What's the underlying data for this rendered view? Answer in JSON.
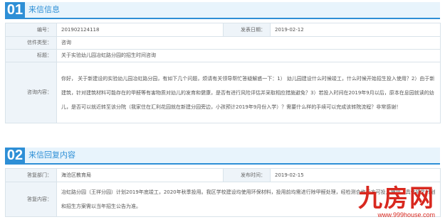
{
  "section1": {
    "num": "01",
    "title": "来信信息",
    "rows": {
      "number_label": "编号：",
      "number_value": "201902124118",
      "date_label": "发表日期：",
      "date_value": "2019-02-12",
      "type_label": "信件类型：",
      "type_value": "咨询",
      "subject_label": "标题：",
      "subject_value": "关于实验幼儿园冶虹路分园的招生时间咨询",
      "content_label": "咨询内容：",
      "content_value": "你好， 关于新建设的实验幼儿园冶虹路分园，有如下几个问题，烦请有关领导帮忙答疑解惑一下：1） 幼儿园建设什么时候竣工，什么时候开始招生投入使用？2）由于新建筑，针对建筑材料可能存在的甲醛等有害物质对幼儿的发育和健康，是否有进行风险评估并采取相应措施避免？3）若投入时间在2019年9月以后，原本在息园就读的幼儿，是否可以就近转至该分院（我家住在汇利花园就在新建分园旁边，小孩预计2019年9月份入学）？需要什么样的手续可以完成该转院流程？非常感谢！"
    }
  },
  "section2": {
    "num": "02",
    "title": "来信回复内容",
    "rows": {
      "dept_label": "答复部门：",
      "dept_value": "海沧区教育局",
      "pubdate_label": "发布时间：",
      "pubdate_value": "2019-02-15",
      "reply_label": "答复内容：",
      "reply_value": "冶虹路分园（王祥分园）计划2019年底竣工，2020年秋季投用。我区学校建设均使用环保材料，投用前均需进行除甲醛处理，经检测合格后方可投入使用。具体招生计划和招生方案需以当年招生公告为准。"
    }
  },
  "watermark": {
    "brand": "九房网",
    "url": "www.999house.com",
    "color": "#d8281f"
  },
  "colors": {
    "accent": "#2e8fd6",
    "header_bg": "#e8f4fc",
    "label_bg": "#eef4f9",
    "border": "#d9e3ea"
  }
}
